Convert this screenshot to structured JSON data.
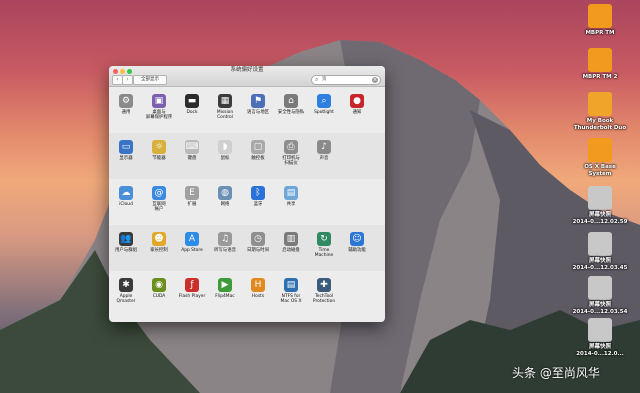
{
  "window": {
    "title": "系统偏好设置",
    "show_all_label": "全部显示",
    "back_glyph": "‹",
    "forward_glyph": "›",
    "search_value": "资",
    "search_clear_glyph": "×"
  },
  "prefs": [
    {
      "label": "通用",
      "icon": "gear-icon",
      "glyph": "⚙",
      "color": "#8a8a8a"
    },
    {
      "label": "桌面与\n屏幕保护程序",
      "icon": "desktop-picture-icon",
      "glyph": "▣",
      "color": "#7d5fb0"
    },
    {
      "label": "Dock",
      "icon": "dock-icon",
      "glyph": "▬",
      "color": "#2b2b2b"
    },
    {
      "label": "Mission\nControl",
      "icon": "mission-control-icon",
      "glyph": "▦",
      "color": "#3c3c3c"
    },
    {
      "label": "语言与地区",
      "icon": "flag-icon",
      "glyph": "⚑",
      "color": "#4d6fb8"
    },
    {
      "label": "安全性与隐私",
      "icon": "house-lock-icon",
      "glyph": "⌂",
      "color": "#7a7a7a"
    },
    {
      "label": "Spotlight",
      "icon": "magnifier-icon",
      "glyph": "⌕",
      "color": "#2f7fe0"
    },
    {
      "label": "通知",
      "icon": "notification-icon",
      "glyph": "●",
      "color": "#c9242b"
    },
    {
      "label": "显示器",
      "icon": "display-icon",
      "glyph": "▭",
      "color": "#3a74c5"
    },
    {
      "label": "节能器",
      "icon": "lightbulb-icon",
      "glyph": "☼",
      "color": "#d7b13c"
    },
    {
      "label": "键盘",
      "icon": "keyboard-icon",
      "glyph": "⌨",
      "color": "#b9b9b9"
    },
    {
      "label": "鼠标",
      "icon": "mouse-icon",
      "glyph": "◗",
      "color": "#cfcfcf"
    },
    {
      "label": "触控板",
      "icon": "trackpad-icon",
      "glyph": "▢",
      "color": "#a9a9a9"
    },
    {
      "label": "打印机与\n扫描仪",
      "icon": "printer-icon",
      "glyph": "⎙",
      "color": "#8e8e8e"
    },
    {
      "label": "声音",
      "icon": "speaker-icon",
      "glyph": "♪",
      "color": "#8a8a8a"
    },
    {
      "label": "iCloud",
      "icon": "cloud-icon",
      "glyph": "☁",
      "color": "#4a90d9"
    },
    {
      "label": "互联网\n帐户",
      "icon": "at-sign-icon",
      "glyph": "@",
      "color": "#3a8be0"
    },
    {
      "label": "扩展",
      "icon": "extensions-icon",
      "glyph": "E",
      "color": "#a0a0a0"
    },
    {
      "label": "网络",
      "icon": "globe-icon",
      "glyph": "◍",
      "color": "#6c8fb5"
    },
    {
      "label": "蓝牙",
      "icon": "bluetooth-icon",
      "glyph": "ᛒ",
      "color": "#2a72d8"
    },
    {
      "label": "共享",
      "icon": "sharing-folder-icon",
      "glyph": "▤",
      "color": "#6fa6d8"
    },
    {
      "label": "用户与群组",
      "icon": "users-icon",
      "glyph": "👥",
      "color": "#3b3b3b"
    },
    {
      "label": "家长控制",
      "icon": "parental-controls-icon",
      "glyph": "☻",
      "color": "#e0a92a"
    },
    {
      "label": "App Store",
      "icon": "app-store-icon",
      "glyph": "A",
      "color": "#2e8be6"
    },
    {
      "label": "听写与语音",
      "icon": "microphone-icon",
      "glyph": "♫",
      "color": "#9a9a9a"
    },
    {
      "label": "日期与时间",
      "icon": "clock-icon",
      "glyph": "◷",
      "color": "#8f8f8f"
    },
    {
      "label": "启动磁盘",
      "icon": "disk-icon",
      "glyph": "▥",
      "color": "#7b7b7b"
    },
    {
      "label": "Time Machine",
      "icon": "time-machine-icon",
      "glyph": "↻",
      "color": "#2f8a63"
    },
    {
      "label": "辅助功能",
      "icon": "accessibility-icon",
      "glyph": "☺",
      "color": "#2c76d6"
    },
    {
      "label": "Apple\nQmaster",
      "icon": "qmaster-icon",
      "glyph": "✱",
      "color": "#3a3a3a"
    },
    {
      "label": "CUDA",
      "icon": "cuda-icon",
      "glyph": "◉",
      "color": "#6b8f1f"
    },
    {
      "label": "Flash Player",
      "icon": "flash-icon",
      "glyph": "ƒ",
      "color": "#c9302c"
    },
    {
      "label": "Flip4Mac",
      "icon": "flip4mac-icon",
      "glyph": "▶",
      "color": "#3f9b3a"
    },
    {
      "label": "Hosts",
      "icon": "hosts-icon",
      "glyph": "H",
      "color": "#e0891f"
    },
    {
      "label": "NTFS for\nMac OS X",
      "icon": "ntfs-icon",
      "glyph": "▤",
      "color": "#2f6fb0"
    },
    {
      "label": "TechTool\nProtection",
      "icon": "techtool-icon",
      "glyph": "✚",
      "color": "#3c5a7a"
    }
  ],
  "desktop_icons": [
    {
      "label": "MBPR TM",
      "icon": "drive-icon",
      "color": "#f29a1e"
    },
    {
      "label": "MBPR TM 2",
      "icon": "drive-icon",
      "color": "#f29a1e"
    },
    {
      "label": "My Book\nThunderbolt Duo",
      "icon": "drive-icon",
      "color": "#f0a52a"
    },
    {
      "label": "OS X Base\nSystem",
      "icon": "drive-icon",
      "color": "#f29a1e"
    },
    {
      "label": "屏幕快照\n2014-0...12.02.59",
      "icon": "screenshot-icon",
      "color": "#c8c8c8"
    },
    {
      "label": "屏幕快照\n2014-0...12.03.45",
      "icon": "screenshot-icon",
      "color": "#c8c8c8"
    },
    {
      "label": "屏幕快照\n2014-0...12.03.54",
      "icon": "screenshot-icon",
      "color": "#c8c8c8"
    },
    {
      "label": "屏幕快照\n2014-0...12.0...",
      "icon": "screenshot-icon",
      "color": "#c8c8c8"
    }
  ],
  "watermark": "头条 @至尚风华",
  "colors": {
    "close": "#fc605c",
    "minimize": "#fdbc40",
    "zoom": "#34c84a"
  }
}
